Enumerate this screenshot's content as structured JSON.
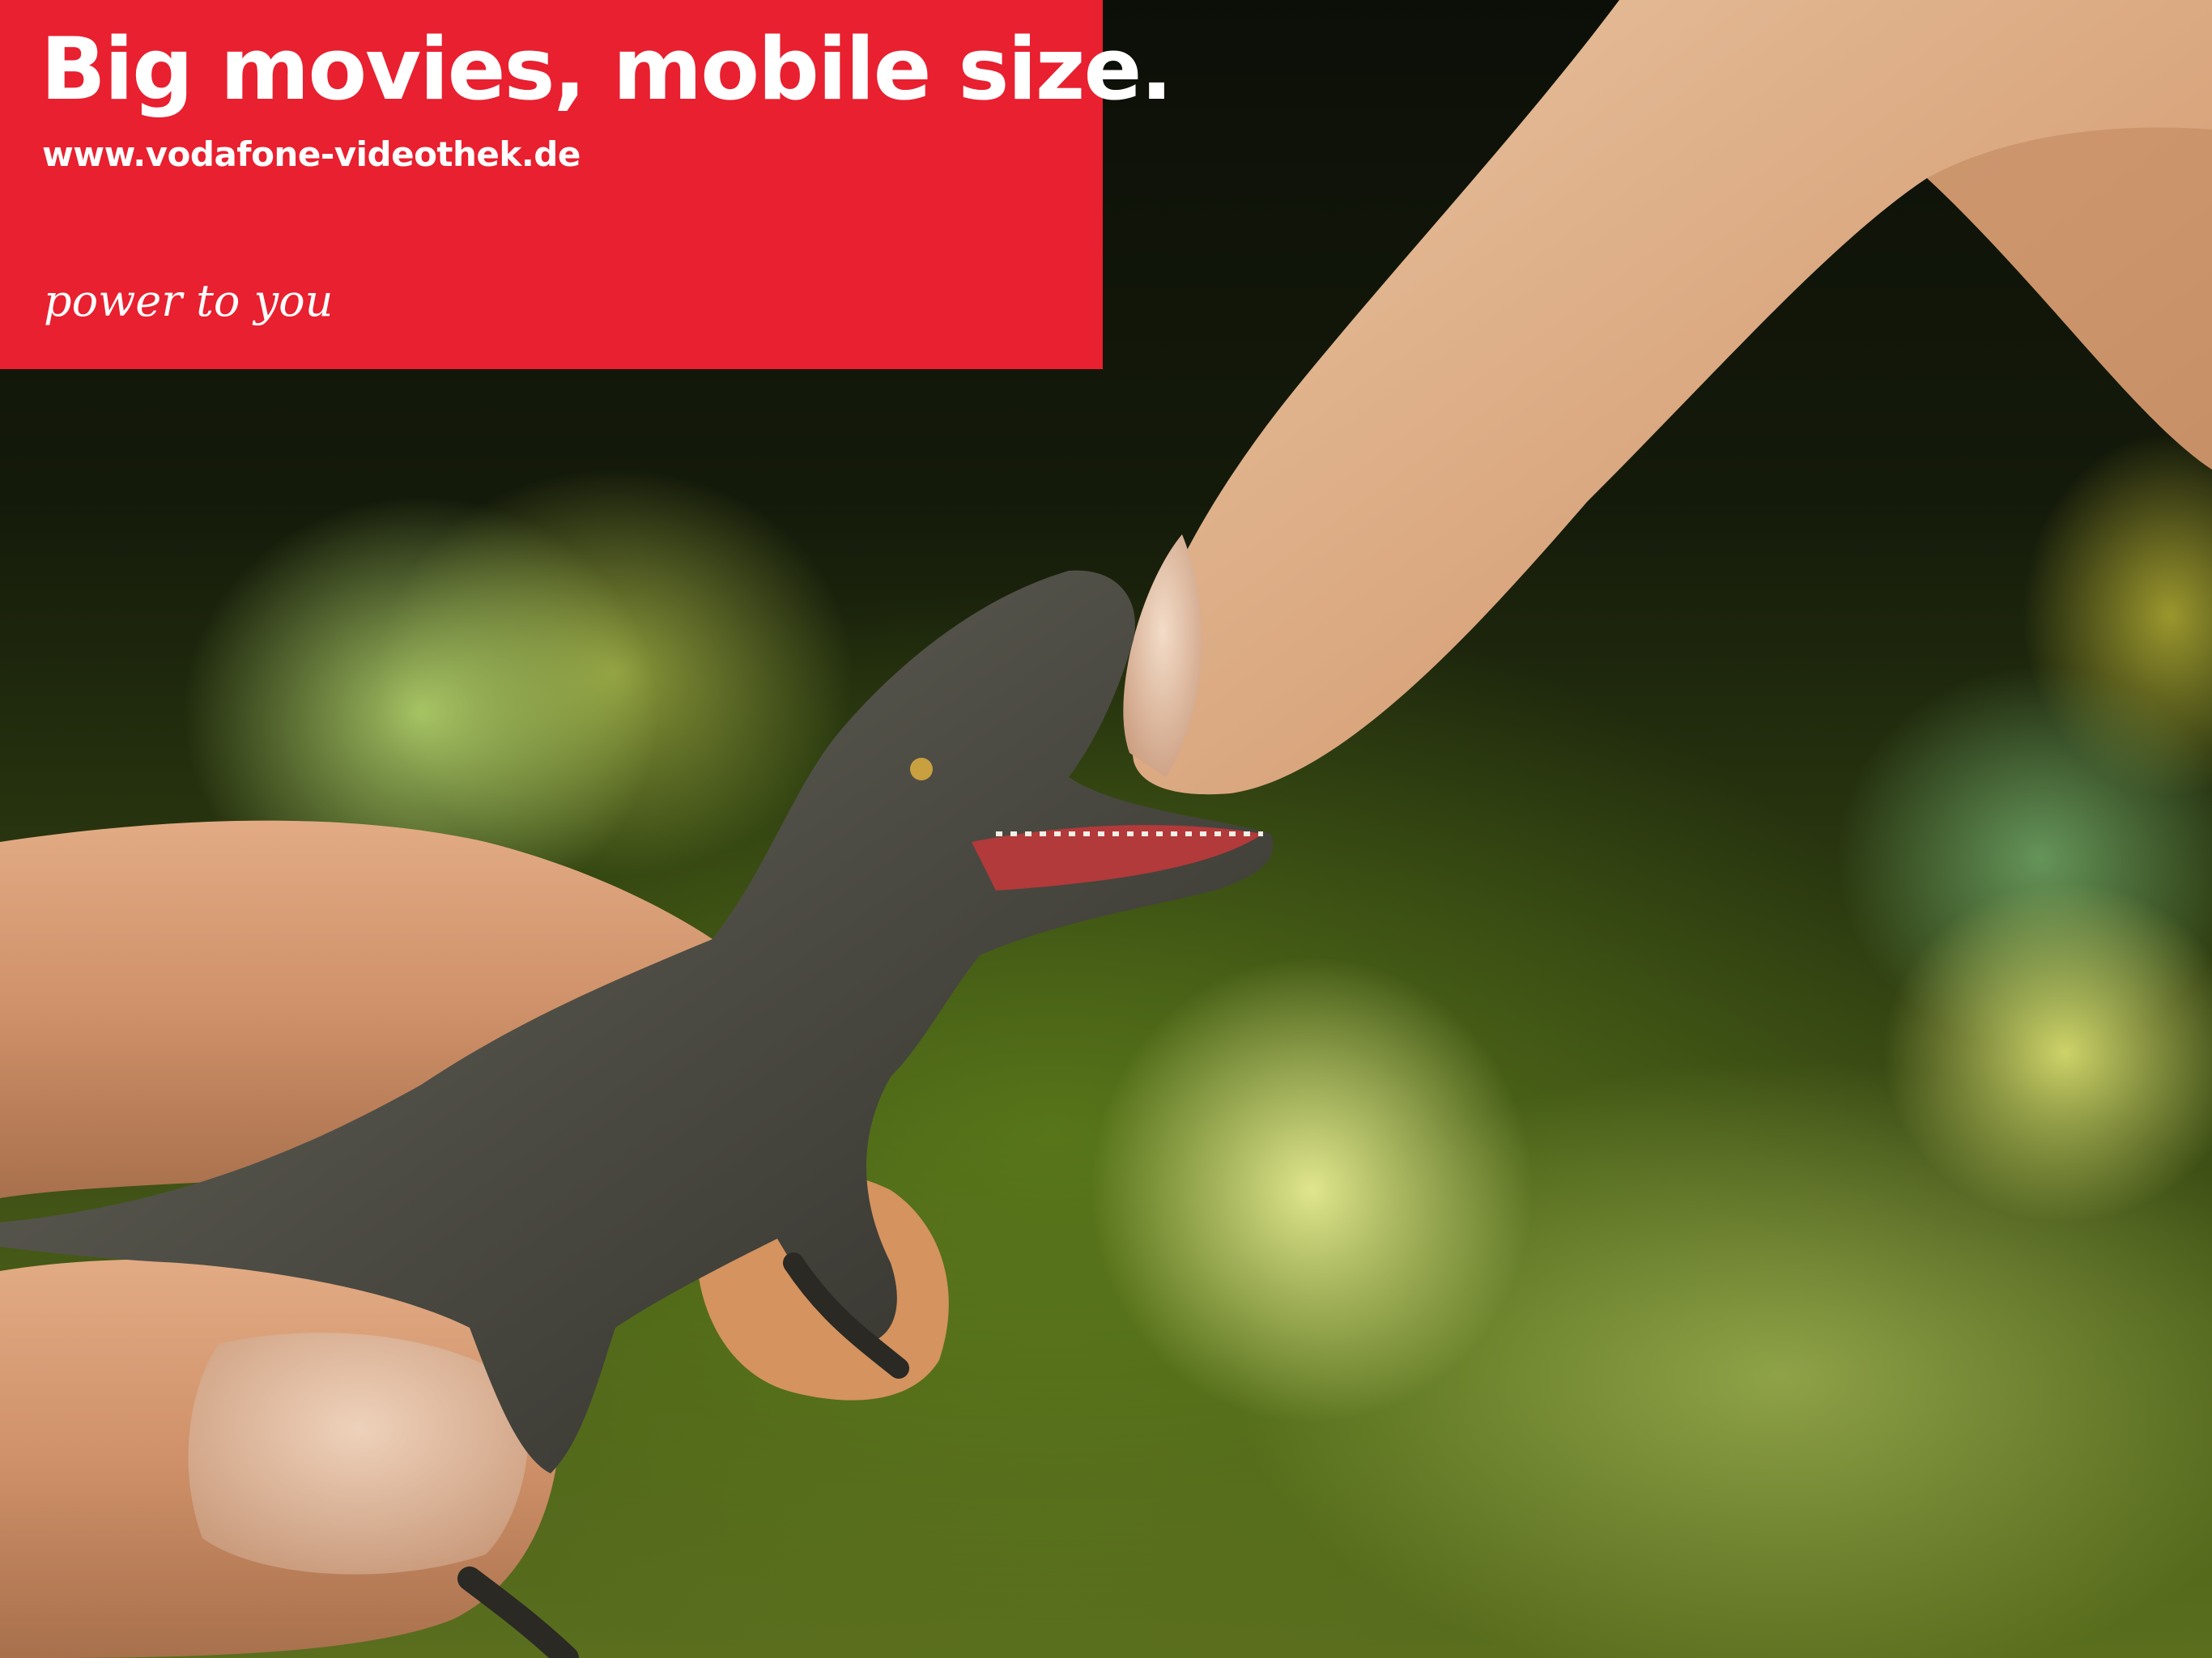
{
  "ad": {
    "headline": "Big movies, mobile size.",
    "url": "www.vodafone-videothek.de",
    "tagline": "power to you"
  },
  "colors": {
    "brand_red": "#e8202f",
    "text": "#ffffff",
    "skin": "#d9a07a",
    "dinosaur": "#4e4c44",
    "bokeh_green": "#b8d850"
  },
  "scene": {
    "subjects": [
      "pointing-finger",
      "holding-hand",
      "miniature-dinosaur"
    ],
    "background": "green-bokeh-lights"
  }
}
